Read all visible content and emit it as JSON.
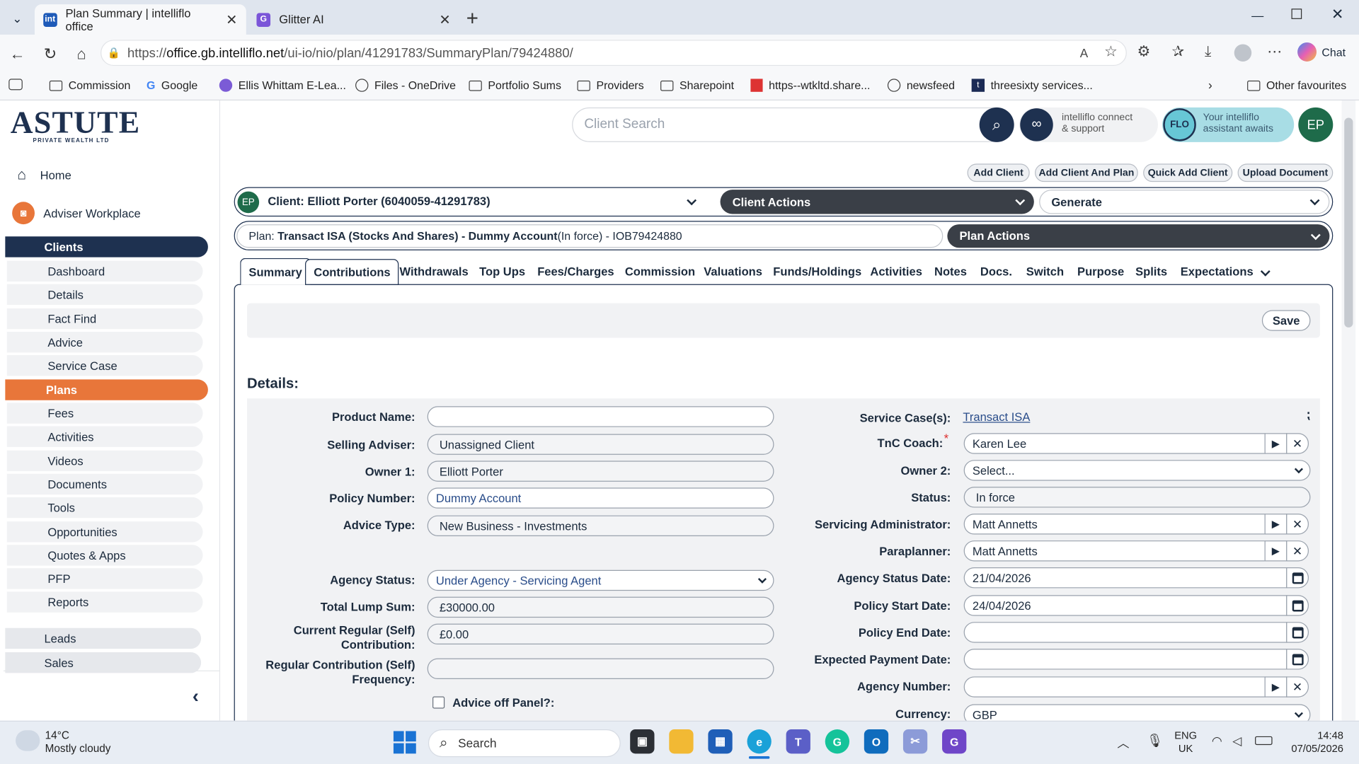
{
  "browser": {
    "tabs": [
      {
        "title": "Plan Summary | intelliflo office",
        "icon": "intelliflo-favicon",
        "close": "✕"
      },
      {
        "title": "Glitter AI",
        "icon": "glitter-favicon",
        "close": "✕"
      }
    ],
    "new_tab": "+",
    "url_prefix": "https://",
    "url_host": "office.gb.intelliflo.net",
    "url_path": "/ui-io/nio/plan/41291783/SummaryPlan/79424880/",
    "chat_label": "Chat",
    "favourites": [
      "Commission",
      "Google",
      "Ellis Whittam E-Lea...",
      "Files - OneDrive",
      "Portfolio Sums",
      "Providers",
      "Sharepoint",
      "https--wtkltd.share...",
      "newsfeed",
      "threesixty services..."
    ],
    "other_favourites": "Other favourites"
  },
  "header": {
    "logo_text": "ASTUTE",
    "logo_sub": "PRIVATE WEALTH LTD",
    "search_placeholder": "Client Search",
    "connect_line1": "intelliflo connect",
    "connect_line2": "& support",
    "flo_badge": "FLO",
    "flo_line1": "Your intelliflo",
    "flo_line2": "assistant awaits",
    "avatar": "EP"
  },
  "sidebar": {
    "home": "Home",
    "workplace": "Adviser Workplace",
    "items": [
      "Clients",
      "Dashboard",
      "Details",
      "Fact Find",
      "Advice",
      "Service Case",
      "Plans",
      "Fees",
      "Activities",
      "Videos",
      "Documents",
      "Tools",
      "Opportunities",
      "Quotes & Apps",
      "PFP",
      "Reports"
    ],
    "groups": [
      "Leads",
      "Sales"
    ]
  },
  "actions": {
    "buttons": [
      "Add Client",
      "Add Client And Plan",
      "Quick Add Client",
      "Upload Document"
    ],
    "client_badge": "EP",
    "client_label": "Client: Elliott Porter (6040059-41291783)",
    "client_actions": "Client Actions",
    "generate": "Generate",
    "plan_prefix": "Plan: ",
    "plan_name": "Transact ISA (Stocks And Shares) - Dummy Account",
    "plan_suffix": " (In force) - IOB79424880",
    "plan_actions": "Plan Actions"
  },
  "plan_tabs": [
    "Summary",
    "Contributions",
    "Withdrawals",
    "Top Ups",
    "Fees/Charges",
    "Commission",
    "Valuations",
    "Funds/Holdings",
    "Activities",
    "Notes",
    "Docs.",
    "Switch",
    "Purpose",
    "Splits",
    "Expectations"
  ],
  "save_label": "Save",
  "details": {
    "title": "Details:",
    "left": [
      {
        "label": "Product Name:",
        "value": ""
      },
      {
        "label": "Selling Adviser:",
        "value": "Unassigned Client"
      },
      {
        "label": "Owner 1:",
        "value": "Elliott Porter"
      },
      {
        "label": "Policy Number:",
        "value": "Dummy Account"
      },
      {
        "label": "Advice Type:",
        "value": "New Business - Investments"
      },
      {
        "label": "Agency Status:",
        "value": "Under Agency - Servicing Agent"
      },
      {
        "label": "Total Lump Sum:",
        "value": "£30000.00"
      },
      {
        "label": "Current Regular (Self) Contribution:",
        "value": "£0.00"
      },
      {
        "label": "Regular Contribution (Self) Frequency:",
        "value": ""
      }
    ],
    "advice_off_panel": "Advice off Panel?:",
    "right": [
      {
        "label": "Service Case(s):",
        "value": "Transact ISA"
      },
      {
        "label": "TnC Coach:",
        "value": "Karen Lee",
        "required": "*"
      },
      {
        "label": "Owner 2:",
        "value": "Select..."
      },
      {
        "label": "Status:",
        "value": "In force"
      },
      {
        "label": "Servicing Administrator:",
        "value": "Matt Annetts"
      },
      {
        "label": "Paraplanner:",
        "value": "Matt Annetts"
      },
      {
        "label": "Agency Status Date:",
        "value": "21/04/2026"
      },
      {
        "label": "Policy Start Date:",
        "value": "24/04/2026"
      },
      {
        "label": "Policy End Date:",
        "value": ""
      },
      {
        "label": "Expected Payment Date:",
        "value": ""
      },
      {
        "label": "Agency Number:",
        "value": ""
      },
      {
        "label": "Currency:",
        "value": "GBP"
      }
    ]
  },
  "taskbar": {
    "temp": "14°C",
    "weather": "Mostly cloudy",
    "search": "Search",
    "lang1": "ENG",
    "lang2": "UK",
    "time": "14:48",
    "date": "07/05/2026"
  }
}
